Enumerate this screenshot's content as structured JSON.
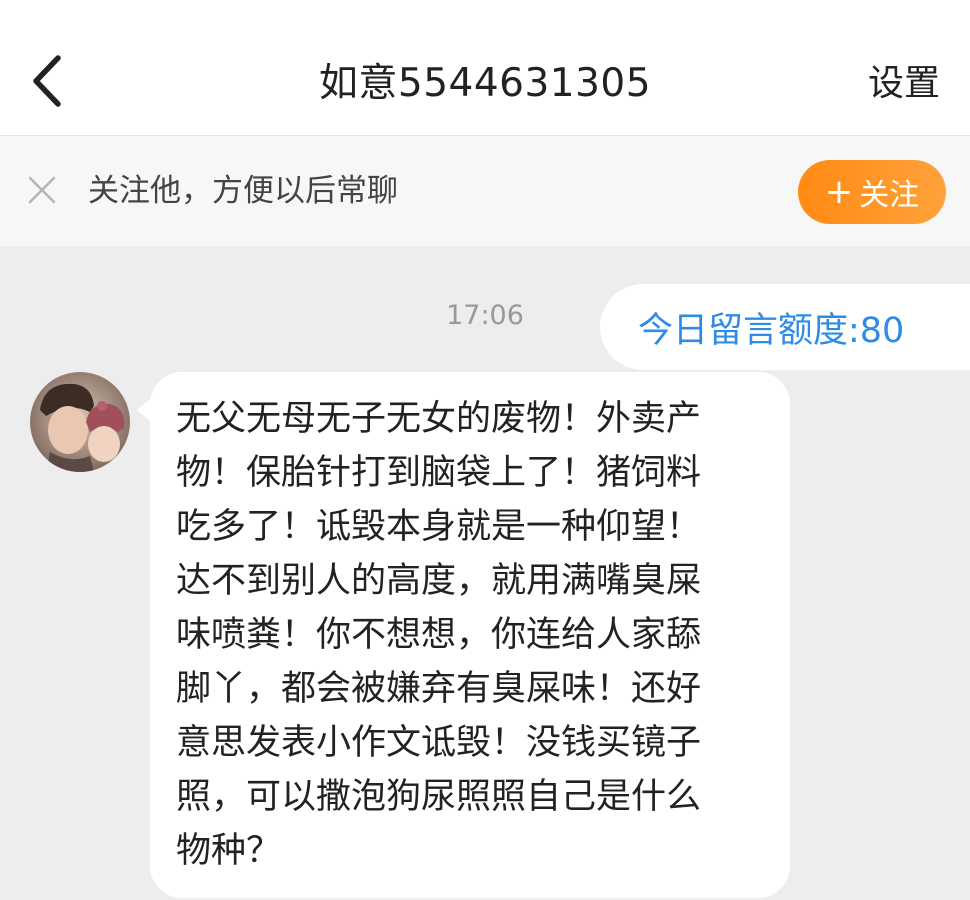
{
  "header": {
    "back_icon": "chevron-left-icon",
    "title": "如意5544631305",
    "settings_label": "设置"
  },
  "follow_bar": {
    "close_icon": "close-icon",
    "tip": "关注他，方便以后常聊",
    "button_icon": "plus-icon",
    "button_plus": "+",
    "button_label": "关注",
    "button_color": "#ff9420"
  },
  "chat": {
    "timestamp": "17:06",
    "quota_text": "今日留言额度:80",
    "quota_color": "#2f8ce6",
    "message": {
      "avatar_icon": "user-avatar",
      "text": "无父无母无子无女的废物！外卖产\n物！保胎针打到脑袋上了！猪饲料\n吃多了！诋毁本身就是一种仰望！\n达不到别人的高度，就用满嘴臭屎\n味喷粪！你不想想，你连给人家舔\n脚丫，都会被嫌弃有臭屎味！还好\n意思发表小作文诋毁！没钱买镜子\n照，可以撒泡狗尿照照自己是什么\n物种？"
    }
  }
}
